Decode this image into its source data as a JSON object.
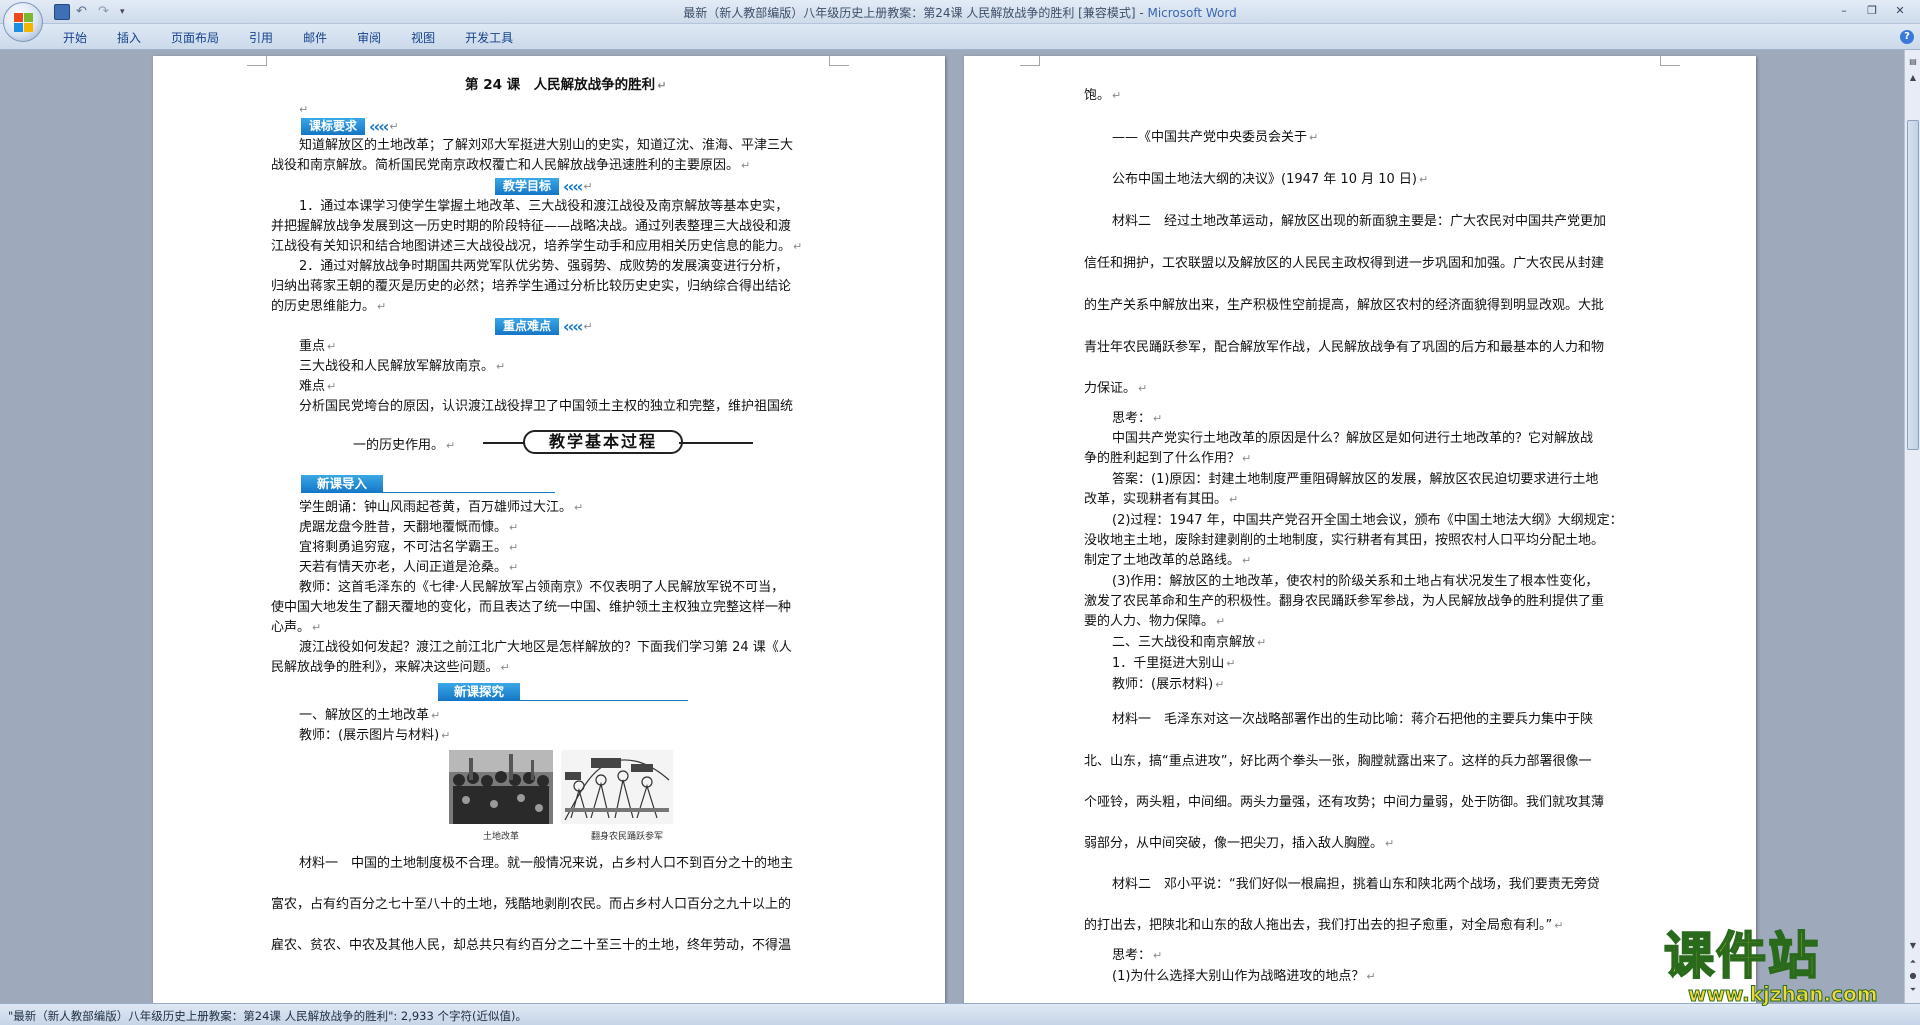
{
  "window": {
    "title_main": "最新（新人教部编版）八年级历史上册教案：第24课 人民解放战争的胜利 [兼容模式] - ",
    "title_app": "Microsoft Word",
    "controls": [
      "–",
      "❐",
      "✕"
    ]
  },
  "ribbon": {
    "tabs": [
      "开始",
      "插入",
      "页面布局",
      "引用",
      "邮件",
      "审阅",
      "视图",
      "开发工具"
    ],
    "help": "?"
  },
  "left_page": {
    "title": "第 24 课　人民解放战争的胜利",
    "b1": "课标要求",
    "p1": "知道解放区的土地改革；了解刘邓大军挺进大别山的史实，知道辽沈、淮海、平津三大",
    "p1b": "战役和南京解放。简析国民党南京政权覆亡和人民解放战争迅速胜利的主要原因。",
    "b2": "教学目标",
    "g1a": "1．通过本课学习使学生掌握土地改革、三大战役和渡江战役及南京解放等基本史实，",
    "g1b": "并把握解放战争发展到这一历史时期的阶段特征——战略决战。通过列表整理三大战役和渡",
    "g1c": "江战役有关知识和结合地图讲述三大战役战况，培养学生动手和应用相关历史信息的能力。",
    "g2a": "2．通过对解放战争时期国共两党军队优劣势、强弱势、成败势的发展演变进行分析，",
    "g2b": "归纳出蒋家王朝的覆灭是历史的必然；培养学生通过分析比较历史史实，归纳综合得出结论",
    "g2c": "的历史思维能力。",
    "b3": "重点难点",
    "k1": "重点",
    "k2": "三大战役和人民解放军解放南京。",
    "k3": "难点",
    "k4": "分析国民党垮台的原因，认识渡江战役捍卫了中国领土主权的独立和完整，维护祖国统",
    "k5": "一的历史作用。",
    "process": "教学基本过程",
    "b4": "新课导入",
    "s1": "学生朗诵：钟山风雨起苍黄，百万雄师过大江。",
    "s2": "虎踞龙盘今胜昔，天翻地覆慨而慷。",
    "s3": "宜将剩勇追穷寇，不可沽名学霸王。",
    "s4": "天若有情天亦老，人间正道是沧桑。",
    "s5": "教师：这首毛泽东的《七律·人民解放军占领南京》不仅表明了人民解放军锐不可当，",
    "s6": "使中国大地发生了翻天覆地的变化，而且表达了统一中国、维护领土主权独立完整这样一种",
    "s7": "心声。",
    "s8": "渡江战役如何发起？渡江之前江北广大地区是怎样解放的？下面我们学习第 24 课《人",
    "s9": "民解放战争的胜利》，来解决这些问题。",
    "b5": "新课探究",
    "t1": "一、解放区的土地改革",
    "t2": "教师：(展示图片与材料)",
    "cap1": "土地改革",
    "cap2": "翻身农民踊跃参军",
    "m1": "材料一　中国的土地制度极不合理。就一般情况来说，占乡村人口不到百分之十的地主",
    "m2": "富农，占有约百分之七十至八十的土地，残酷地剥削农民。而占乡村人口百分之九十以上的",
    "m3": "雇农、贫农、中农及其他人民，却总共只有约百分之二十至三十的土地，终年劳动，不得温"
  },
  "right_page": {
    "r1": "饱。",
    "r2": "——《中国共产党中央委员会关于",
    "r3": "公布中国土地法大纲的决议》(1947 年 10 月 10 日)",
    "r4": "材料二　经过土地改革运动，解放区出现的新面貌主要是：广大农民对中国共产党更加",
    "r5": "信任和拥护，工农联盟以及解放区的人民民主政权得到进一步巩固和加强。广大农民从封建",
    "r6": "的生产关系中解放出来，生产积极性空前提高，解放区农村的经济面貌得到明显改观。大批",
    "r7": "青壮年农民踊跃参军，配合解放军作战，人民解放战争有了巩固的后方和最基本的人力和物",
    "r8": "力保证。",
    "r9": "思考：",
    "r10": "中国共产党实行土地改革的原因是什么？解放区是如何进行土地改革的？它对解放战",
    "r11": "争的胜利起到了什么作用？",
    "r12": "答案：(1)原因：封建土地制度严重阻碍解放区的发展，解放区农民迫切要求进行土地",
    "r13": "改革，实现耕者有其田。",
    "r14": "(2)过程：1947 年，中国共产党召开全国土地会议，颁布《中国土地法大纲》大纲规定：",
    "r15": "没收地主土地，废除封建剥削的土地制度，实行耕者有其田，按照农村人口平均分配土地。",
    "r16": "制定了土地改革的总路线。",
    "r17": "(3)作用：解放区的土地改革，使农村的阶级关系和土地占有状况发生了根本性变化，",
    "r18": "激发了农民革命和生产的积极性。翻身农民踊跃参军参战，为人民解放战争的胜利提供了重",
    "r19": "要的人力、物力保障。",
    "r20": "二、三大战役和南京解放",
    "r21": "1．千里挺进大别山",
    "r22": "教师：(展示材料)",
    "r23": "材料一　毛泽东对这一次战略部署作出的生动比喻：蒋介石把他的主要兵力集中于陕",
    "r24": "北、山东，搞“重点进攻”，好比两个拳头一张，胸膛就露出来了。这样的兵力部署很像一",
    "r25": "个哑铃，两头粗，中间细。两头力量强，还有攻势；中间力量弱，处于防御。我们就攻其薄",
    "r26": "弱部分，从中间突破，像一把尖刀，插入敌人胸膛。",
    "r27": "材料二　邓小平说：“我们好似一根扁担，挑着山东和陕北两个战场，我们要责无旁贷",
    "r28": "的打出去，把陕北和山东的敌人拖出去，我们打出去的担子愈重，对全局愈有利。”",
    "r29": "思考：",
    "r30": "(1)为什么选择大别山作为战略进攻的地点？"
  },
  "status": {
    "text": "\"最新（新人教部编版）八年级历史上册教案：第24课 人民解放战争的胜利\": 2,933 个字符(近似值)。"
  },
  "watermark": {
    "logo": "课件站",
    "url": "www.kjzhan.com"
  }
}
